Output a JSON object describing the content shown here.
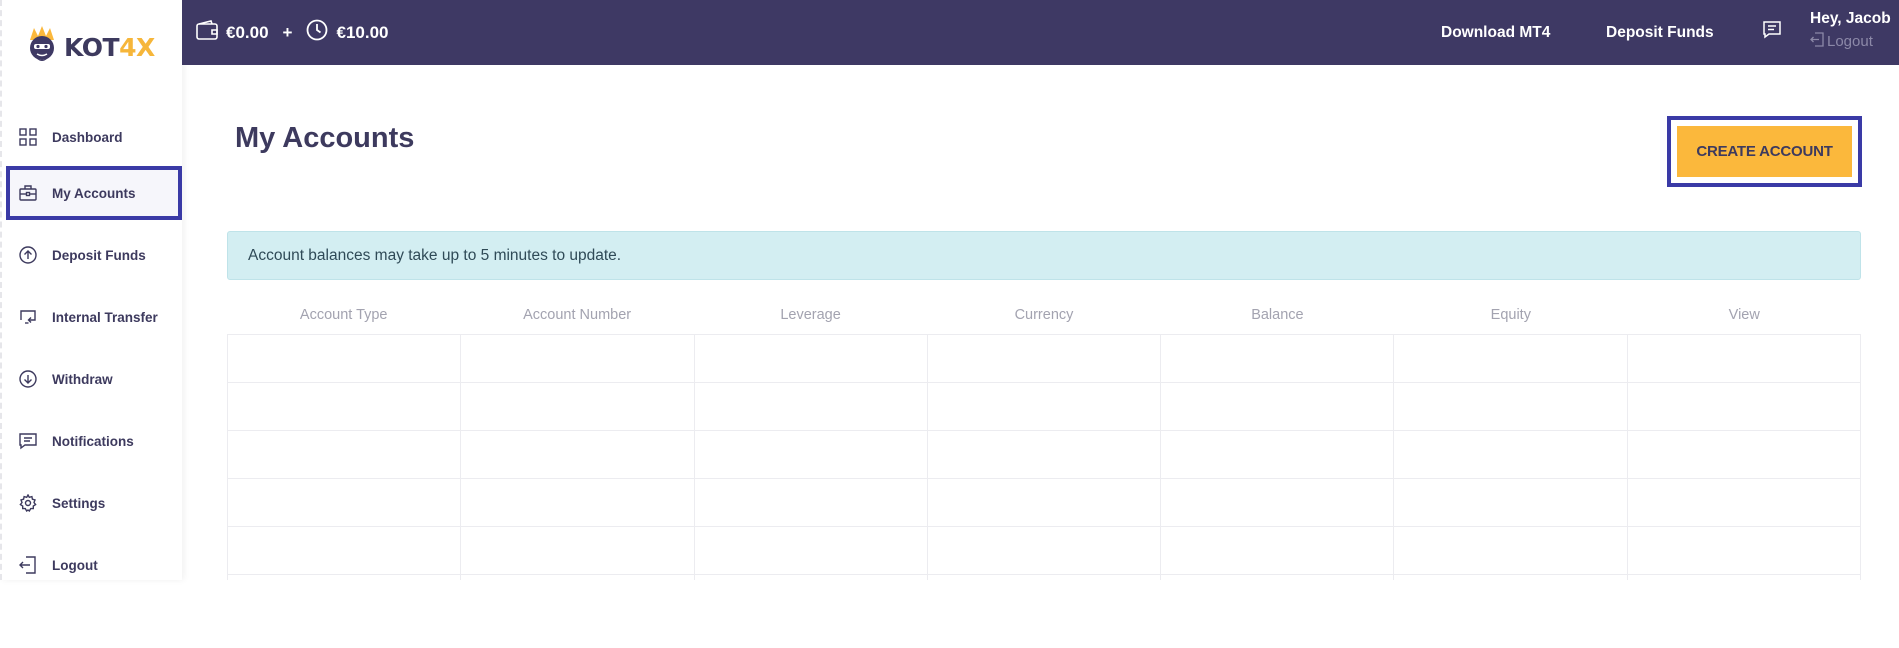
{
  "brand": {
    "logo_text_a": "KOT",
    "logo_text_b": "4X",
    "colors": {
      "primary": "#3e3964",
      "accent": "#fbb83c",
      "highlight": "#3a3aa6"
    }
  },
  "sidebar": {
    "items": [
      {
        "label": "Dashboard",
        "icon": "grid-icon"
      },
      {
        "label": "My Accounts",
        "icon": "briefcase-icon",
        "active": true
      },
      {
        "label": "Deposit Funds",
        "icon": "arrow-up-circle-icon"
      },
      {
        "label": "Internal Transfer",
        "icon": "transfer-icon"
      },
      {
        "label": "Withdraw",
        "icon": "arrow-down-circle-icon"
      },
      {
        "label": "Notifications",
        "icon": "message-icon"
      },
      {
        "label": "Settings",
        "icon": "gear-icon"
      },
      {
        "label": "Logout",
        "icon": "logout-icon"
      }
    ]
  },
  "topbar": {
    "wallet_balance": "€0.00",
    "plus": "+",
    "pending_balance": "€10.00",
    "download_label": "Download MT4",
    "deposit_label": "Deposit Funds",
    "greeting": "Hey, Jacob",
    "logout_label": "Logout"
  },
  "main": {
    "title": "My Accounts",
    "create_button": "CREATE ACCOUNT",
    "alert": "Account balances may take up to 5 minutes to update.",
    "table": {
      "columns": [
        "Account Type",
        "Account Number",
        "Leverage",
        "Currency",
        "Balance",
        "Equity",
        "View"
      ],
      "rows": 5
    }
  }
}
